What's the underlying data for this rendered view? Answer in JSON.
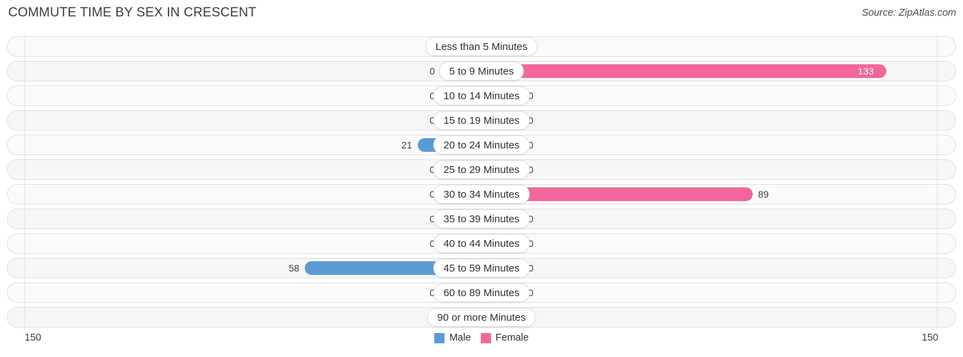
{
  "header": {
    "title": "COMMUTE TIME BY SEX IN CRESCENT",
    "source": "Source: ZipAtlas.com"
  },
  "legend": {
    "male_label": "Male",
    "female_label": "Female"
  },
  "axis": {
    "left_max_label": "150",
    "right_max_label": "150"
  },
  "colors": {
    "male": "#5b9bd5",
    "male_muted": "#a8c8ea",
    "female": "#f2669c",
    "female_muted": "#f7a8c4",
    "track": "#fafafa",
    "track_border": "#e0e0e0",
    "gridline": "#e2e2e2",
    "title": "#3b3b47"
  },
  "chart_data": {
    "type": "bar",
    "title": "COMMUTE TIME BY SEX IN CRESCENT",
    "subtitle": "",
    "xlabel": "",
    "ylabel": "",
    "orientation": "horizontal-diverging",
    "grid": false,
    "legend_position": "bottom-center",
    "axis_max": 150,
    "xlim": [
      150,
      150
    ],
    "categories": [
      "Less than 5 Minutes",
      "5 to 9 Minutes",
      "10 to 14 Minutes",
      "15 to 19 Minutes",
      "20 to 24 Minutes",
      "25 to 29 Minutes",
      "30 to 34 Minutes",
      "35 to 39 Minutes",
      "40 to 44 Minutes",
      "45 to 59 Minutes",
      "60 to 89 Minutes",
      "90 or more Minutes"
    ],
    "series": [
      {
        "name": "Male",
        "side": "left",
        "color": "#5b9bd5",
        "values": [
          0,
          0,
          0,
          0,
          21,
          0,
          0,
          0,
          0,
          58,
          0,
          0
        ]
      },
      {
        "name": "Female",
        "side": "right",
        "color": "#f2669c",
        "values": [
          0,
          133,
          0,
          0,
          0,
          0,
          89,
          0,
          0,
          0,
          0,
          0
        ]
      }
    ],
    "value_labels": {
      "male": [
        "0",
        "0",
        "0",
        "0",
        "21",
        "0",
        "0",
        "0",
        "0",
        "58",
        "0",
        "0"
      ],
      "female": [
        "0",
        "133",
        "0",
        "0",
        "0",
        "0",
        "89",
        "0",
        "0",
        "0",
        "0",
        "0"
      ]
    }
  }
}
